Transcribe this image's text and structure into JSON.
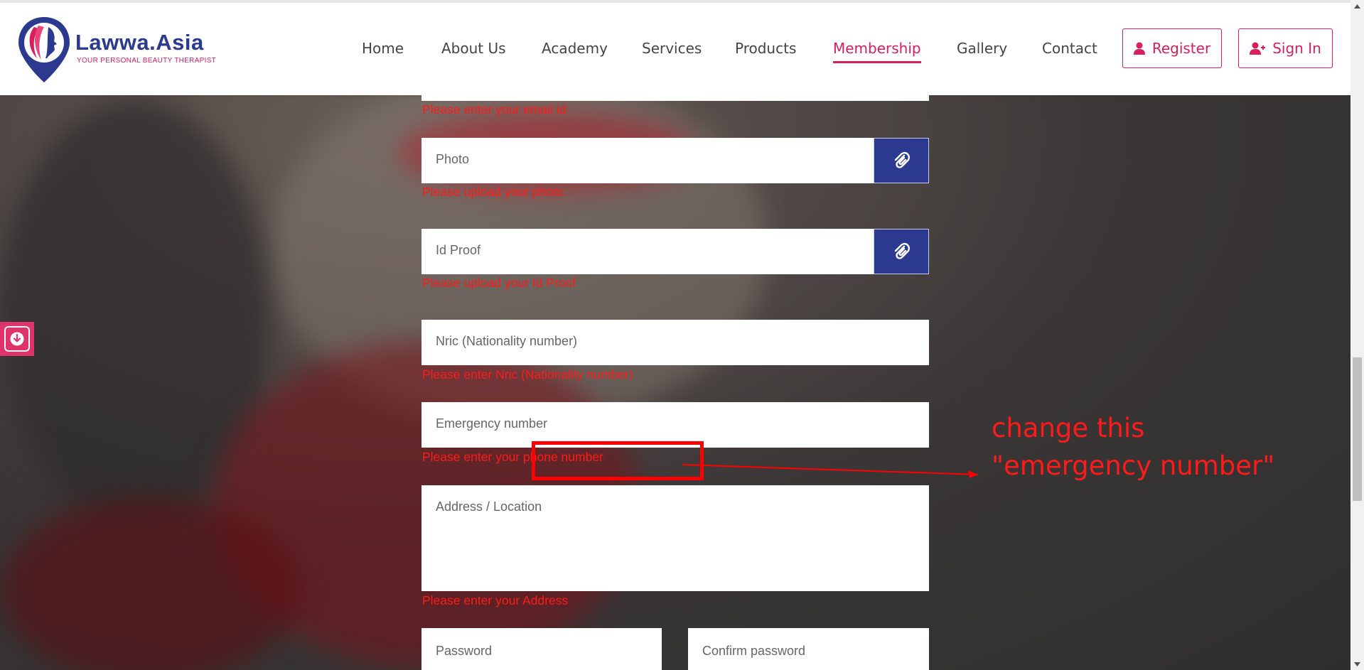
{
  "brand": {
    "name": "Lawwa.Asia",
    "tagline": "YOUR PERSONAL BEAUTY THERAPIST",
    "primary_color": "#2b3a8f",
    "accent_color": "#d81e5b"
  },
  "nav": {
    "items": [
      {
        "label": "Home"
      },
      {
        "label": "About Us"
      },
      {
        "label": "Academy"
      },
      {
        "label": "Services"
      },
      {
        "label": "Products"
      },
      {
        "label": "Membership",
        "active": true
      },
      {
        "label": "Gallery"
      },
      {
        "label": "Contact"
      }
    ],
    "register_label": "Register",
    "signin_label": "Sign In"
  },
  "form": {
    "email_error": "Please enter your email id",
    "photo": {
      "placeholder": "Photo",
      "error": "Please upload your photo",
      "icon": "paperclip-icon"
    },
    "id_proof": {
      "placeholder": "Id Proof",
      "error": "Please upload your Id Proof",
      "icon": "paperclip-icon"
    },
    "nric": {
      "placeholder": "Nric (Nationality number)",
      "error": "Please enter Nric (Nationality number)"
    },
    "emergency": {
      "placeholder": "Emergency number",
      "error": "Please enter your phone number"
    },
    "address": {
      "placeholder": "Address / Location",
      "error": "Please enter your Address"
    },
    "password": {
      "placeholder": "Password"
    },
    "confirm_password": {
      "placeholder": "Confirm password"
    }
  },
  "annotation": {
    "text": "change this\n\"emergency number\"",
    "color": "#ff0000"
  },
  "side_widget": {
    "icon": "download-icon"
  }
}
